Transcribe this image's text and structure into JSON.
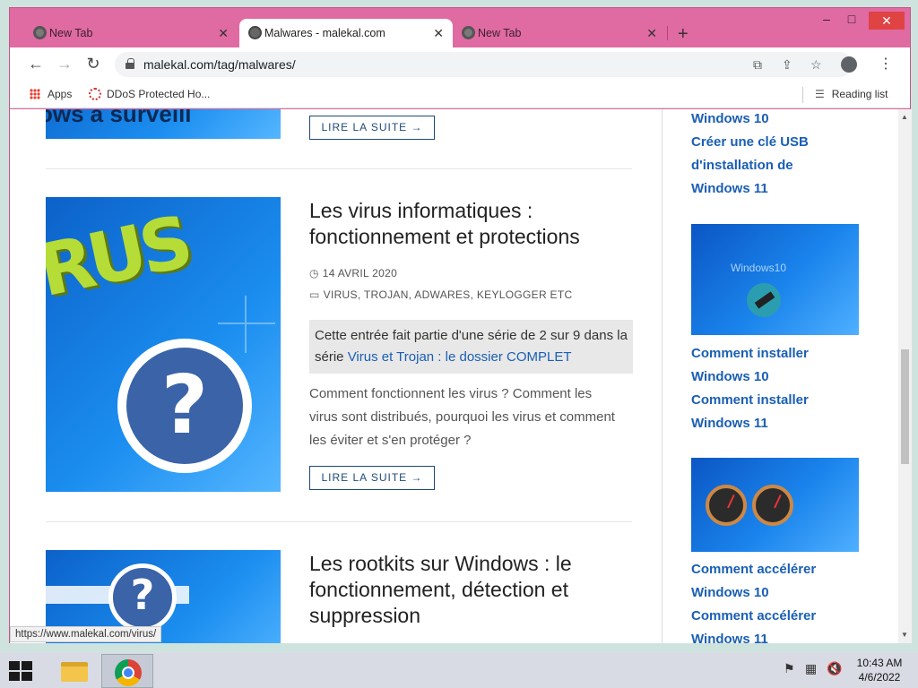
{
  "browser": {
    "tabs": [
      {
        "label": "New Tab"
      },
      {
        "label": "Malwares - malekal.com"
      },
      {
        "label": "New Tab"
      }
    ],
    "new_tab_symbol": "+",
    "window_controls": {
      "minimize": "–",
      "maximize": "□",
      "close": "✕"
    },
    "url": "malekal.com/tag/malwares/",
    "bookmarks": {
      "apps": "Apps",
      "ddos": "DDoS Protected Ho...",
      "reading_list": "Reading list"
    },
    "status_url": "https://www.malekal.com/virus/"
  },
  "page": {
    "top_thumb_text": "ows à surveill",
    "posts": [
      {
        "more_label": "LIRE LA SUITE →"
      },
      {
        "title": "Les virus informatiques : fonctionnement et protections",
        "date": "14 AVRIL 2020",
        "categories": [
          "VIRUS, TROJAN, ADWARES, KEYLOGGER ETC"
        ],
        "series_text": "Cette entrée fait partie d'une série de 2 sur 9 dans la série ",
        "series_link": "Virus et Trojan : le dossier COMPLET",
        "excerpt": "Comment fonctionnent les virus ? Comment les virus sont distribués, pourquoi les virus et comment les éviter et s'en protéger ?",
        "more_label": "LIRE LA SUITE →"
      },
      {
        "title": "Les rootkits sur Windows : le fonctionnement, détection et suppression"
      }
    ],
    "sidebar": {
      "links_top": [
        "Windows 10",
        "Créer une clé USB d'installation de Windows 11"
      ],
      "img1_caption": "Windows10",
      "links_mid": [
        "Comment installer Windows 10",
        "Comment installer Windows 11"
      ],
      "links_bottom": [
        "Comment accélérer Windows 10",
        "Comment accélérer Windows 11"
      ]
    }
  },
  "taskbar": {
    "time": "10:43 AM",
    "date": "4/6/2022"
  },
  "colors": {
    "window_frame": "#e06aa2",
    "link": "#1a5fb4",
    "button_border": "#1d4a78"
  }
}
